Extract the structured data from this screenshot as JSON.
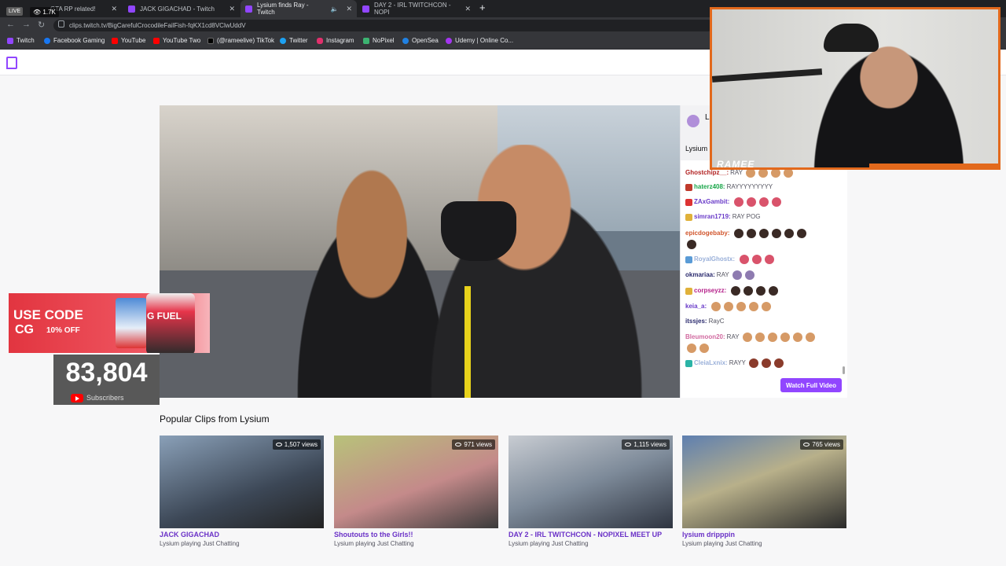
{
  "browser": {
    "tabs": [
      {
        "label": "GTA RP related!"
      },
      {
        "label": "JACK GIGACHAD - Twitch"
      },
      {
        "label": "Lysium finds Ray - Twitch"
      },
      {
        "label": "DAY 2 - IRL TWITCHCON - NOPI"
      }
    ],
    "live_label": "LIVE",
    "viewer_count": "1.7K",
    "url": "clips.twitch.tv/BigCarefulCrocodileFailFish-fqKX1cd8VClwUddV",
    "bookmarks": [
      "Twitch",
      "Facebook Gaming",
      "YouTube",
      "YouTube Two",
      "(@rameelive) TikTok",
      "Twitter",
      "Instagram",
      "NoPixel",
      "OpenSea",
      "Udemy | Online Co..."
    ]
  },
  "chat": {
    "channel_letter": "L",
    "channel_name": "Lysium",
    "messages": [
      {
        "user": "Ghostchipz__:",
        "user_color": "#b22222",
        "text": "RAY"
      },
      {
        "user": "haterz408:",
        "user_color": "#1aa64a",
        "text": "RAYYYYYYYYY"
      },
      {
        "user": "ZAxGambit:",
        "user_color": "#6a3cc9",
        "text": ""
      },
      {
        "user": "simran1719:",
        "user_color": "#6a3cc9",
        "text": "RAY POG"
      },
      {
        "user": "epicdogebaby:",
        "user_color": "#d1562d",
        "text": ""
      },
      {
        "user": "RoyalGhostx:",
        "user_color": "#9ab0d9",
        "text": ""
      },
      {
        "user": "okmariaa:",
        "user_color": "#2b2b6e",
        "text": "RAY"
      },
      {
        "user": "corpseyzz:",
        "user_color": "#b5218a",
        "text": ""
      },
      {
        "user": "keia_a:",
        "user_color": "#6a3cc9",
        "text": ""
      },
      {
        "user": "itssjes:",
        "user_color": "#2b2b6e",
        "text": "RayC"
      },
      {
        "user": "Bleumoon20:",
        "user_color": "#d16aa0",
        "text": "RAY"
      },
      {
        "user": "CleiaLxnix:",
        "user_color": "#9ab0d9",
        "text": "RAYY"
      }
    ],
    "watch_full_video": "Watch Full Video"
  },
  "overlay": {
    "cam_label": "RAMEE",
    "promo_use_code": "USE CODE",
    "promo_code": "CG",
    "promo_discount": "10% OFF",
    "promo_brand": "G FUEL",
    "subscriber_count": "83,804",
    "subscriber_label": "Subscribers"
  },
  "popular": {
    "title": "Popular Clips from Lysium",
    "clips": [
      {
        "title": "JACK GIGACHAD",
        "sub": "Lysium playing Just Chatting",
        "views": "1,507 views",
        "color": "#4a5b6d"
      },
      {
        "title": "Shoutouts to the Girls!!",
        "sub": "Lysium playing Just Chatting",
        "views": "971 views",
        "color": "#7b8a55"
      },
      {
        "title": "DAY 2 - IRL TWITCHCON - NOPIXEL MEET UP",
        "sub": "Lysium playing Just Chatting",
        "views": "1,115 views",
        "color": "#6d7c8c"
      },
      {
        "title": "lysium dripppin",
        "sub": "Lysium playing Just Chatting",
        "views": "765 views",
        "color": "#5f6a45"
      }
    ]
  }
}
